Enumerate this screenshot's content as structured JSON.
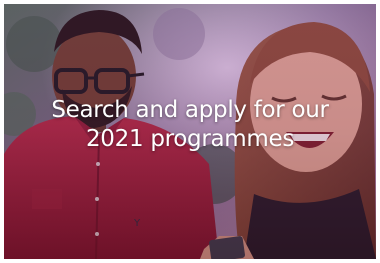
{
  "hero": {
    "headline_line1": "Search and apply for our",
    "headline_line2": "2021 programmes"
  },
  "colors": {
    "text": "#ffffff",
    "tint": "#8c3c96"
  }
}
